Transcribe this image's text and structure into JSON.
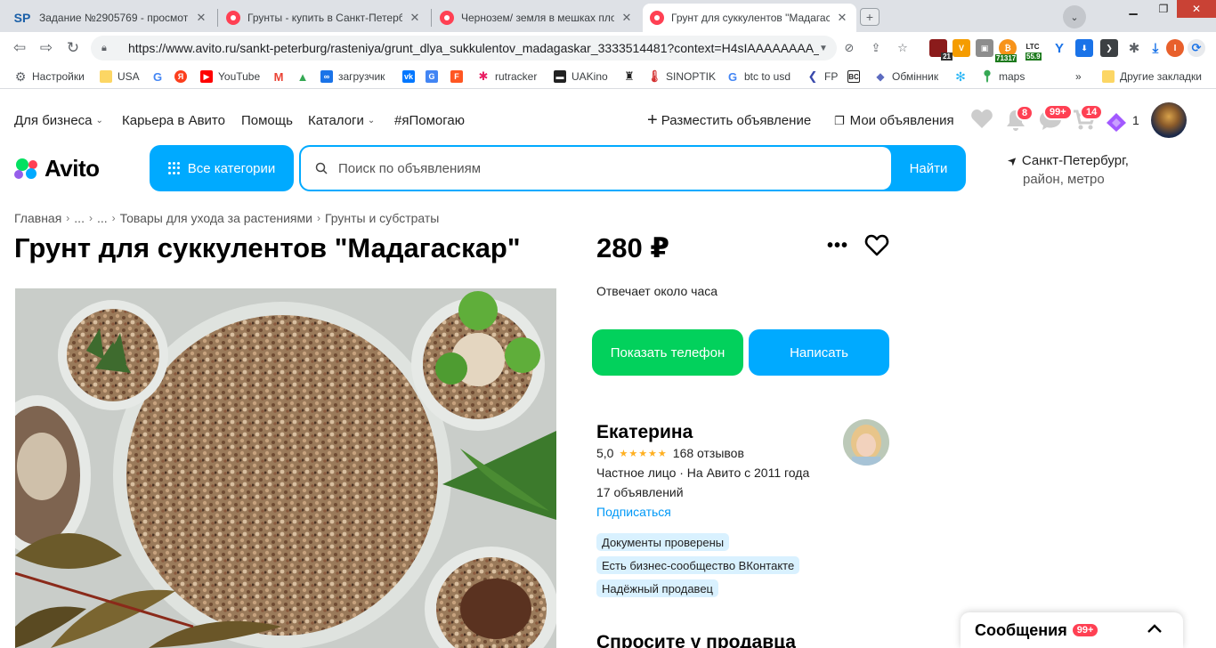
{
  "browser": {
    "tabs": [
      {
        "title": "Задание №2905769 - просмотр з",
        "fav": "SP"
      },
      {
        "title": "Грунты - купить в Санкт-Петербу"
      },
      {
        "title": "Чернозем/ земля в мешках плод"
      },
      {
        "title": "Грунт для суккулентов \"Мадагаск"
      }
    ],
    "url": "https://www.avito.ru/sankt-peterburg/rasteniya/grunt_dlya_sukkulentov_madagaskar_3333514481?context=H4sIAAAAAAAA_w",
    "extensions": {
      "badge_21": "21",
      "btc_price": "71317",
      "ltc_label": "LTC",
      "ltc_price": "55.9",
      "profile_initial": "I"
    },
    "bookmarks": [
      {
        "label": "Настройки"
      },
      {
        "label": "USA"
      },
      {
        "label": ""
      },
      {
        "label": ""
      },
      {
        "label": "YouTube"
      },
      {
        "label": ""
      },
      {
        "label": ""
      },
      {
        "label": "загрузчик"
      },
      {
        "label": ""
      },
      {
        "label": ""
      },
      {
        "label": ""
      },
      {
        "label": "rutracker"
      },
      {
        "label": "UAKino"
      },
      {
        "label": ""
      },
      {
        "label": "SINOPTIK"
      },
      {
        "label": "btc to usd"
      },
      {
        "label": "FP"
      },
      {
        "label": ""
      },
      {
        "label": "Обмінник"
      },
      {
        "label": ""
      },
      {
        "label": "maps"
      }
    ],
    "bookmarks_more": "»",
    "other_bookmarks": "Другие закладки"
  },
  "header": {
    "nav": [
      "Для бизнеса",
      "Карьера в Авито",
      "Помощь",
      "Каталоги",
      "#яПомогаю"
    ],
    "post_ad": "Разместить объявление",
    "my_ads": "Мои объявления",
    "notifications_count": "8",
    "messages_count": "99+",
    "cart_count": "14",
    "bonus_count": "1"
  },
  "logo": {
    "text": "Avito"
  },
  "search": {
    "all_categories": "Все категории",
    "placeholder": "Поиск по объявлениям",
    "button": "Найти"
  },
  "location": {
    "line1": "Санкт-Петербург,",
    "line2": "район, метро"
  },
  "breadcrumb": [
    "Главная",
    "...",
    "...",
    "Товары для ухода за растениями",
    "Грунты и субстраты"
  ],
  "listing": {
    "title": "Грунт для суккулентов \"Мадагаскар\"",
    "price": "280 ₽",
    "reply_time": "Отвечает около часа",
    "show_phone": "Показать телефон",
    "write": "Написать"
  },
  "seller": {
    "name": "Екатерина",
    "rating": "5,0",
    "reviews": "168 отзывов",
    "type": "Частное лицо · На Авито с 2011 года",
    "ads_count": "17 объявлений",
    "subscribe": "Подписаться",
    "badges": [
      "Документы проверены",
      "Есть бизнес-сообщество ВКонтакте",
      "Надёжный продавец"
    ],
    "ask_title": "Спросите у продавца"
  },
  "messages_panel": {
    "label": "Сообщения",
    "count": "99+"
  },
  "colors": {
    "brand_blue": "#00aaff",
    "brand_green": "#02d15c",
    "badge_red": "#ff4053",
    "link_blue": "#0099f7"
  }
}
